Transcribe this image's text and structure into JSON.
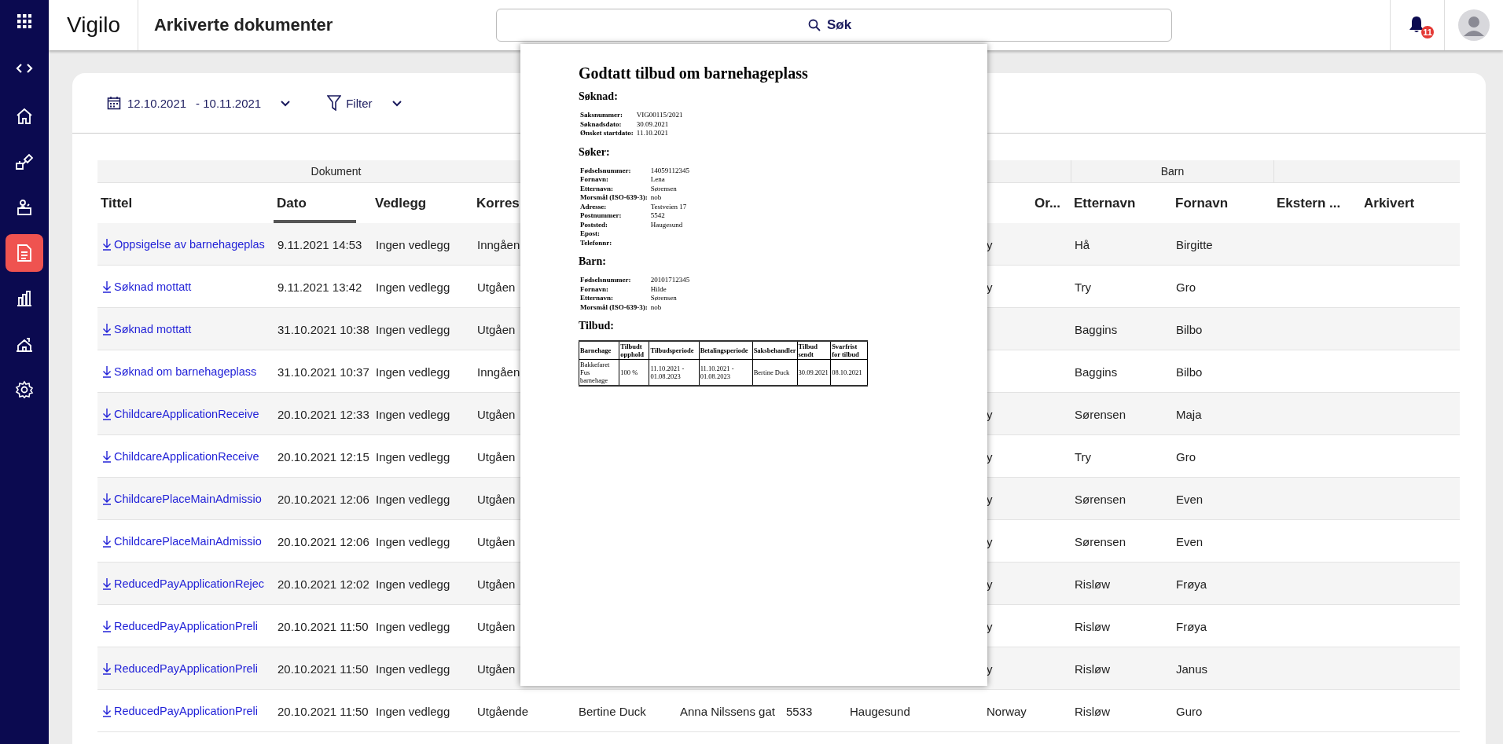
{
  "sidebar": {
    "items": [
      {
        "kind": "home",
        "selected": false
      },
      {
        "kind": "tools",
        "selected": false
      },
      {
        "kind": "desk",
        "selected": false
      },
      {
        "kind": "document",
        "selected": true
      },
      {
        "kind": "chart",
        "selected": false
      },
      {
        "kind": "building",
        "selected": false
      },
      {
        "kind": "settings",
        "selected": false
      }
    ]
  },
  "header": {
    "brand": "Vigilo",
    "page_title": "Arkiverte dokumenter",
    "search": {
      "placeholder": "Søk"
    },
    "notifications": {
      "count": "11"
    }
  },
  "toolbar": {
    "date_from": "12.10.2021",
    "date_to": "- 10.11.2021",
    "filter_label": "Filter"
  },
  "table": {
    "groups": [
      {
        "label": "Dokument"
      },
      {
        "label": "Barn"
      }
    ],
    "columns": [
      {
        "label": "Tittel",
        "sorted": false
      },
      {
        "label": "Dato",
        "sorted": true
      },
      {
        "label": "Vedlegg",
        "sorted": false
      },
      {
        "label": "Korres",
        "sorted": false
      },
      {
        "label": "Or...",
        "sorted": false
      },
      {
        "label": "Etternavn",
        "sorted": false
      },
      {
        "label": "Fornavn",
        "sorted": false
      },
      {
        "label": "Ekstern ...",
        "sorted": false
      },
      {
        "label": "Arkivert",
        "sorted": false
      }
    ],
    "rows": [
      {
        "title": "Oppsigelse av barnehageplas",
        "date": "9.11.2021 14:53",
        "attachments": "Ingen vedlegg",
        "column_4": "Inngåen",
        "column_9": "y",
        "last_name": "Hå",
        "first_name": "Birgitte"
      },
      {
        "title": "Søknad mottatt",
        "date": "9.11.2021 13:42",
        "attachments": "Ingen vedlegg",
        "column_4": "Utgåen",
        "column_9": "y",
        "last_name": "Try",
        "first_name": "Gro"
      },
      {
        "title": "Søknad mottatt",
        "date": "31.10.2021 10:38",
        "attachments": "Ingen vedlegg",
        "column_4": "Utgåen",
        "last_name": "Baggins",
        "first_name": "Bilbo"
      },
      {
        "title": "Søknad om barnehageplass",
        "date": "31.10.2021 10:37",
        "attachments": "Ingen vedlegg",
        "column_4": "Inngåen",
        "last_name": "Baggins",
        "first_name": "Bilbo"
      },
      {
        "title": "ChildcareApplicationReceive",
        "date": "20.10.2021 12:33",
        "attachments": "Ingen vedlegg",
        "column_4": "Utgåen",
        "column_9": "y",
        "last_name": "Sørensen",
        "first_name": "Maja"
      },
      {
        "title": "ChildcareApplicationReceive",
        "date": "20.10.2021 12:15",
        "attachments": "Ingen vedlegg",
        "column_4": "Utgåen",
        "column_9": "y",
        "last_name": "Try",
        "first_name": "Gro"
      },
      {
        "title": "ChildcarePlaceMainAdmissio",
        "date": "20.10.2021 12:06",
        "attachments": "Ingen vedlegg",
        "column_4": "Utgåen",
        "column_9": "y",
        "last_name": "Sørensen",
        "first_name": "Even"
      },
      {
        "title": "ChildcarePlaceMainAdmissio",
        "date": "20.10.2021 12:06",
        "attachments": "Ingen vedlegg",
        "column_4": "Utgåen",
        "column_9": "y",
        "last_name": "Sørensen",
        "first_name": "Even"
      },
      {
        "title": "ReducedPayApplicationRejec",
        "date": "20.10.2021 12:02",
        "attachments": "Ingen vedlegg",
        "column_4": "Utgåen",
        "column_9": "y",
        "last_name": "Risløw",
        "first_name": "Frøya"
      },
      {
        "title": "ReducedPayApplicationPreli",
        "date": "20.10.2021 11:50",
        "attachments": "Ingen vedlegg",
        "column_4": "Utgåen",
        "column_9": "y",
        "last_name": "Risløw",
        "first_name": "Frøya"
      },
      {
        "title": "ReducedPayApplicationPreli",
        "date": "20.10.2021 11:50",
        "attachments": "Ingen vedlegg",
        "column_4": "Utgåen",
        "column_9": "y",
        "last_name": "Risløw",
        "first_name": "Janus"
      },
      {
        "title": "ReducedPayApplicationPreli",
        "date": "20.10.2021 11:50",
        "attachments": "Ingen vedlegg",
        "column_4": "Utgående",
        "column_5": "Bertine Duck",
        "column_6": "Anna Nilssens gat",
        "column_7": "5533",
        "column_8": "Haugesund",
        "column_9": "Norway",
        "last_name": "Risløw",
        "first_name": "Guro"
      }
    ]
  },
  "document_preview": {
    "title": "Godtatt tilbud om barnehageplass",
    "sections": [
      {
        "heading": "Søknad:",
        "fields": [
          {
            "label": "Saksnummer:",
            "value": "VIG00115/2021"
          },
          {
            "label": "Søknadsdato:",
            "value": "30.09.2021"
          },
          {
            "label": "Ønsket startdato:",
            "value": "11.10.2021"
          }
        ]
      },
      {
        "heading": "Søker:",
        "fields": [
          {
            "label": "Fødselsnummer:",
            "value": "14059112345"
          },
          {
            "label": "Fornavn:",
            "value": "Lena"
          },
          {
            "label": "Etternavn:",
            "value": "Sørensen"
          },
          {
            "label": "Morsmål (ISO-639-3):",
            "value": "nob"
          },
          {
            "label": "Adresse:",
            "value": "Testveien 17"
          },
          {
            "label": "Postnummer:",
            "value": "5542"
          },
          {
            "label": "Poststed:",
            "value": "Haugesund"
          },
          {
            "label": "Epost:"
          },
          {
            "label": "Telefonnr:"
          }
        ]
      },
      {
        "heading": "Barn:",
        "fields": [
          {
            "label": "Fødselsnummer:",
            "value": "20101712345"
          },
          {
            "label": "Fornavn:",
            "value": "Hilde"
          },
          {
            "label": "Etternavn:",
            "value": "Sørensen"
          },
          {
            "label": "Morsmål (ISO-639-3):",
            "value": "nob"
          }
        ]
      },
      {
        "heading": "Tilbud:",
        "table": {
          "columns": [
            "Barnehage",
            "Tilbudt opphold",
            "Tilbudsperiode",
            "Betalingsperiode",
            "Saksbehandler",
            "Tilbud sendt",
            "Svarfrist for tilbud"
          ],
          "rows": [
            [
              "Bakkefaret Fus barnehage",
              "100 %",
              "11.10.2021 - 01.08.2023",
              "11.10.2021 - 01.08.2023",
              "Bertine Duck",
              "30.09.2021",
              "08.10.2021"
            ]
          ]
        }
      }
    ]
  }
}
